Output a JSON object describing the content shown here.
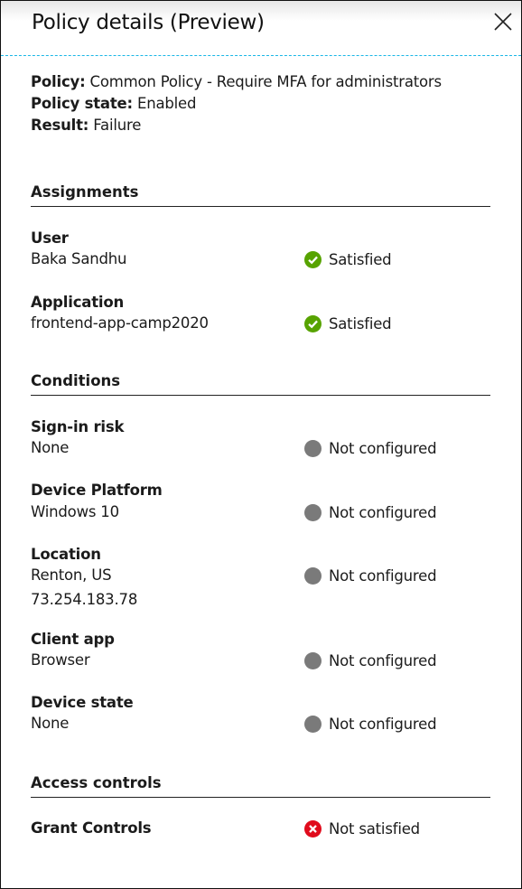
{
  "header": {
    "title": "Policy details (Preview)",
    "close_icon": "close-icon"
  },
  "summary": {
    "policy_label": "Policy:",
    "policy_value": "Common Policy - Require MFA for administrators",
    "state_label": "Policy state:",
    "state_value": "Enabled",
    "result_label": "Result:",
    "result_value": "Failure"
  },
  "assignments": {
    "heading": "Assignments",
    "items": [
      {
        "label": "User",
        "value": "Baka Sandhu",
        "status": "Satisfied"
      },
      {
        "label": "Application",
        "value": "frontend-app-camp2020",
        "status": "Satisfied"
      }
    ]
  },
  "conditions": {
    "heading": "Conditions",
    "items": [
      {
        "label": "Sign-in risk",
        "value": "None",
        "status": "Not configured"
      },
      {
        "label": "Device Platform",
        "value": "Windows 10",
        "status": "Not configured"
      },
      {
        "label": "Location",
        "value": "Renton, US",
        "value2": "73.254.183.78",
        "status": "Not configured"
      },
      {
        "label": "Client app",
        "value": "Browser",
        "status": "Not configured"
      },
      {
        "label": "Device state",
        "value": "None",
        "status": "Not configured"
      }
    ]
  },
  "access_controls": {
    "heading": "Access controls",
    "items": [
      {
        "label": "Grant Controls",
        "status": "Not satisfied"
      }
    ]
  },
  "colors": {
    "satisfied": "#57a300",
    "not_configured": "#7a7a7a",
    "not_satisfied": "#e00b1c",
    "accent": "#1ab7e6"
  }
}
